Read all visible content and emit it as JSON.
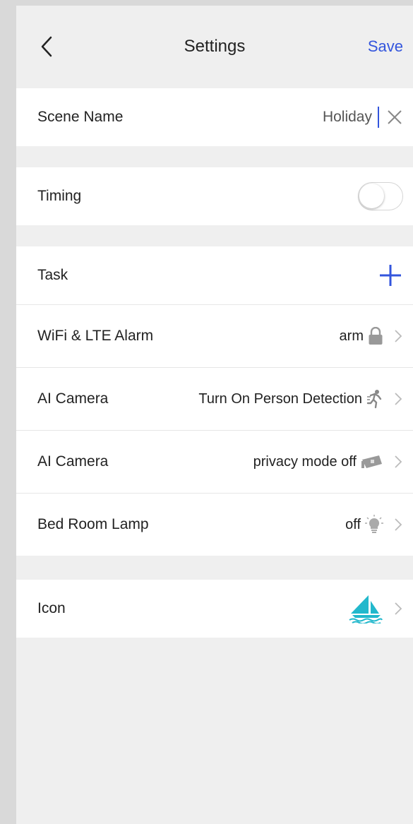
{
  "header": {
    "title": "Settings",
    "save_label": "Save"
  },
  "scene": {
    "label": "Scene Name",
    "value": "Holiday"
  },
  "timing": {
    "label": "Timing",
    "enabled": false
  },
  "task": {
    "label": "Task",
    "items": [
      {
        "label": "WiFi & LTE Alarm",
        "value": "arm",
        "icon": "lock-icon"
      },
      {
        "label": "AI Camera",
        "value": "Turn On Person Detection",
        "icon": "running-person-icon"
      },
      {
        "label": "AI Camera",
        "value": "privacy mode off",
        "icon": "camera-icon"
      },
      {
        "label": "Bed Room Lamp",
        "value": "off",
        "icon": "bulb-icon"
      }
    ]
  },
  "icon_row": {
    "label": "Icon",
    "icon": "sailboat-icon"
  },
  "colors": {
    "accent": "#3355dd",
    "sailboat": "#22b8cc",
    "background": "#efefef"
  }
}
